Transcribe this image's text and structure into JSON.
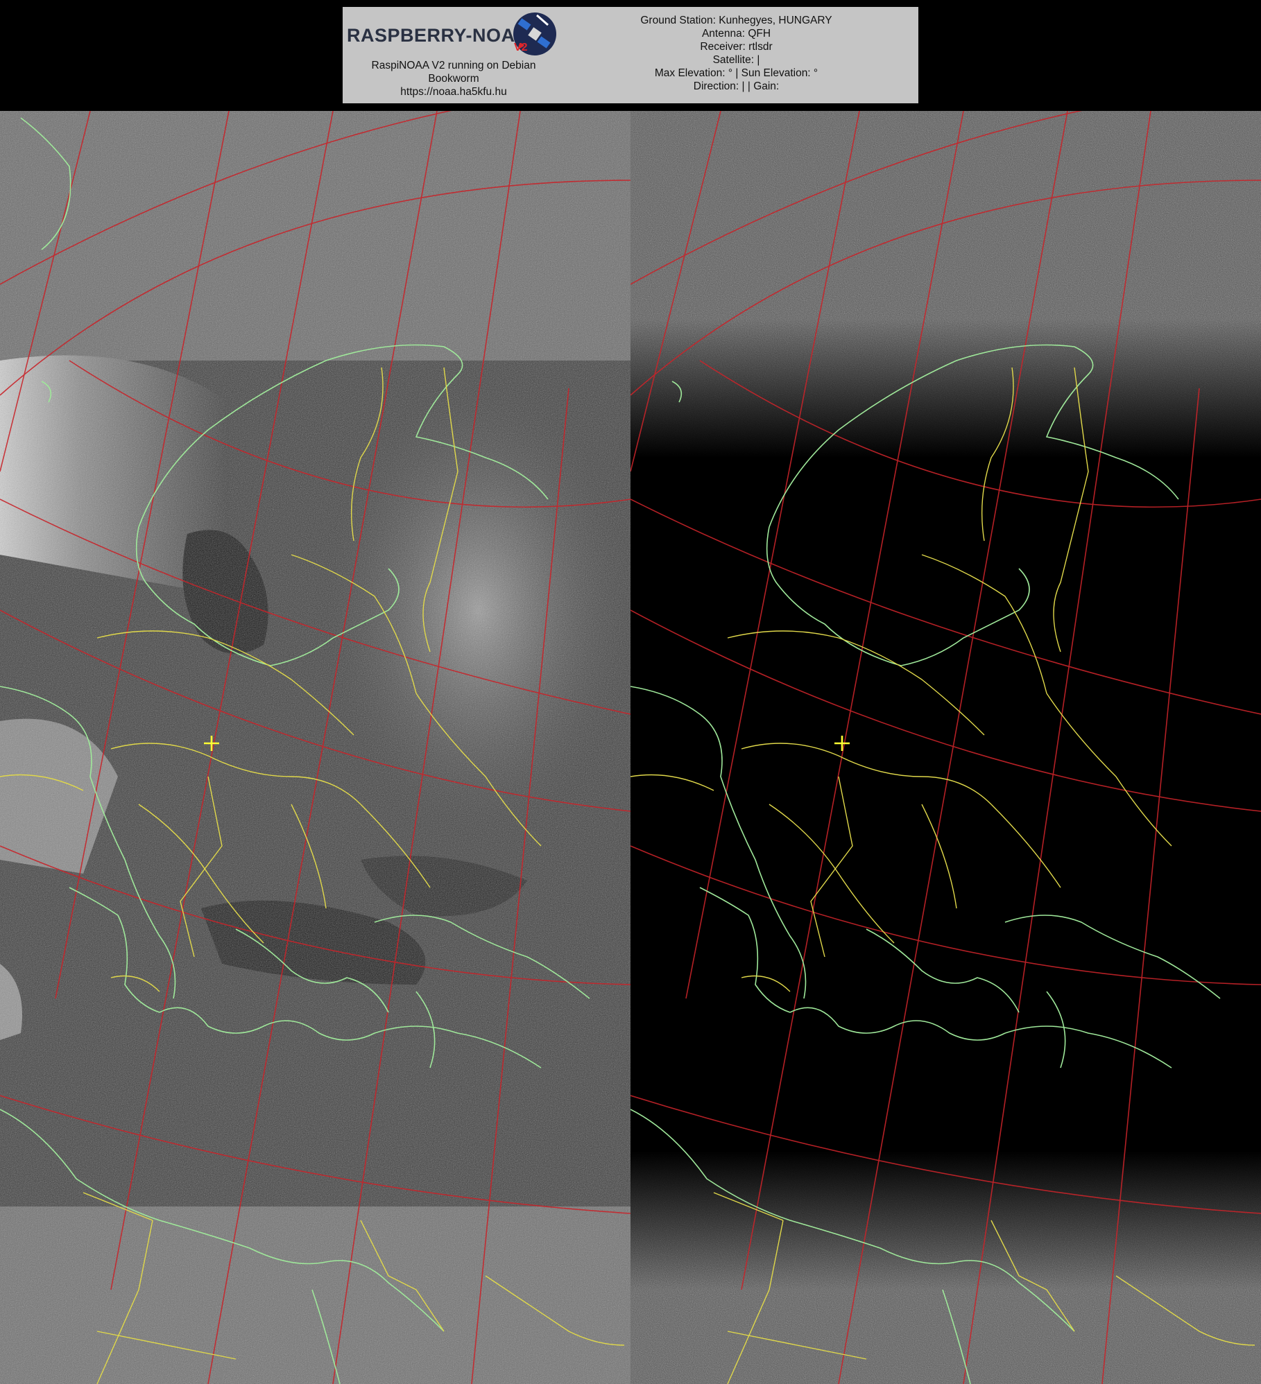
{
  "banner": {
    "logo_text_main": "RASPBERRY-NOAA",
    "logo_text_v": "V2",
    "left_lines": [
      "RaspiNOAA V2 running on Debian",
      "Bookworm",
      "https://noaa.ha5kfu.hu"
    ],
    "station_lines": [
      "Ground Station: Kunhegyes, HUNGARY",
      "Antenna: QFH",
      "Receiver: rtlsdr",
      "Satellite: |",
      "Max Elevation: ° | Sun Elevation: °",
      "Direction: | | Gain:"
    ]
  },
  "imagery": {
    "left_panel": "visible-channel",
    "right_panel": "infrared-channel",
    "colors": {
      "coastline": "#9fe89a",
      "borders": "#e0d84a",
      "graticule": "#c8242a",
      "station_marker": "#ffff33",
      "banner_bg": "#c5c5c5"
    }
  }
}
